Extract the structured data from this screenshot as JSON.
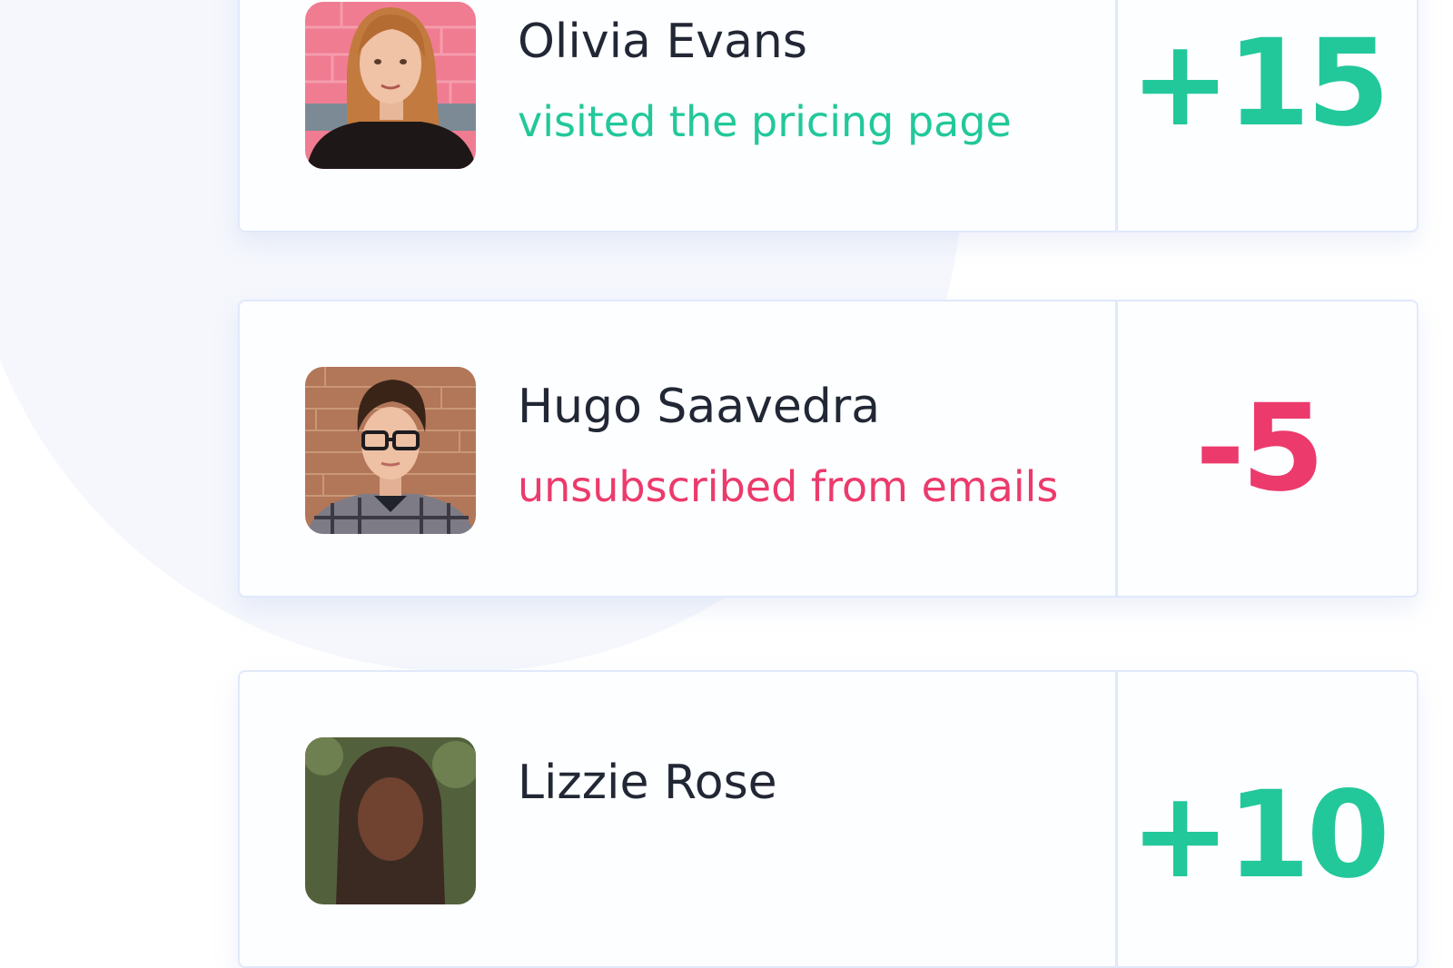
{
  "activity_feed": {
    "items": [
      {
        "name": "Olivia Evans",
        "activity": "visited the pricing page",
        "score": "+15",
        "tone": "positive"
      },
      {
        "name": "Hugo Saavedra",
        "activity": "unsubscribed from emails",
        "score": "-5",
        "tone": "negative"
      },
      {
        "name": "Lizzie Rose",
        "activity": "",
        "score": "+10",
        "tone": "positive"
      }
    ]
  },
  "colors": {
    "positive": "#22c89a",
    "negative": "#ec3a6c",
    "name_text": "#222735",
    "card_border": "#e1e9fb",
    "background_circle": "#f5f7fd"
  }
}
